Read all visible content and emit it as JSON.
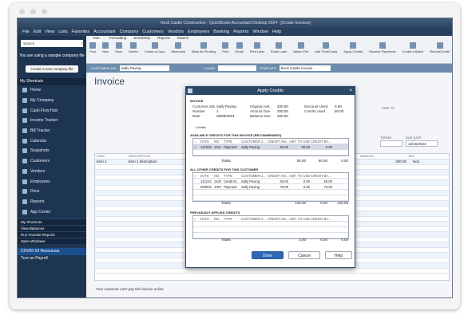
{
  "window": {
    "title": "Rock Castle Construction - QuickBooks Accountant Desktop 2024 - [Create Invoices]"
  },
  "menu": [
    "File",
    "Edit",
    "View",
    "Lists",
    "Favorites",
    "Accountant",
    "Company",
    "Customers",
    "Vendors",
    "Employees",
    "Banking",
    "Reports",
    "Window",
    "Help"
  ],
  "sidebar": {
    "search_placeholder": "Search",
    "sample_notice": "You are using a sample company file",
    "create_button": "Create a new company file",
    "my_shortcuts": "My Shortcuts",
    "items": [
      {
        "label": "Home"
      },
      {
        "label": "My Company"
      },
      {
        "label": "Cash Flow Hub"
      },
      {
        "label": "Income Tracker"
      },
      {
        "label": "Bill Tracker"
      },
      {
        "label": "Calendar"
      },
      {
        "label": "Snapshots"
      },
      {
        "label": "Customers"
      },
      {
        "label": "Vendors"
      },
      {
        "label": "Employees"
      },
      {
        "label": "Docs"
      },
      {
        "label": "Reports"
      },
      {
        "label": "App Center"
      }
    ],
    "sections": [
      "My Shortcuts",
      "View Balances",
      "Run Favorite Reports",
      "Open Windows"
    ],
    "covid": "COVID-19 Resources",
    "turn_on_payroll": "Turn on Payroll"
  },
  "ribbon": {
    "tabs": [
      "Main",
      "Formatting",
      "Send/Ship",
      "Reports",
      "Search"
    ],
    "tools": [
      "Find",
      "New",
      "Save",
      "Delete",
      "Create a Copy",
      "Memorize",
      "Mark As Pending",
      "Print",
      "Email",
      "Print Later",
      "Email Later",
      "Attach File",
      "Add Time/Costs",
      "Apply Credits",
      "Receive Payments",
      "Create a Batch",
      "Refund/Credit"
    ]
  },
  "customer_bar": {
    "customer_job_label": "CUSTOMER:JOB",
    "customer_job_value": "Sally Paving",
    "class_label": "CLASS",
    "template_label": "TEMPLATE",
    "template_value": "Rock Castle Invoice"
  },
  "invoice": {
    "title": "Invoice",
    "terms_label": "TERMS",
    "ship_to_label": "SHIP TO",
    "date_label": "DATE",
    "due_date_label": "DUE DATE",
    "due_date": "12/15/2024",
    "columns": [
      "ITEM",
      "DESCRIPTION",
      "",
      "",
      "",
      "AMOUNT",
      "TAX"
    ],
    "rows": [
      {
        "item": "Item 1",
        "description": "Item 1 description",
        "rate": "200.00",
        "tax": "Non"
      }
    ],
    "note": "Your customer can't pay this invoice online"
  },
  "dialog": {
    "title": "Apply Credits",
    "invoice_section": "INVOICE",
    "fields_left": [
      {
        "k": "Customer:Job",
        "v": "Sally Paving"
      },
      {
        "k": "Number",
        "v": "1"
      },
      {
        "k": "Date",
        "v": "08/09/2024"
      }
    ],
    "fields_mid": [
      {
        "k": "Original Amt.",
        "v": "200.00"
      },
      {
        "k": "Amount Due",
        "v": "200.00"
      },
      {
        "k": "Balance Due",
        "v": "200.00"
      }
    ],
    "fields_right": [
      {
        "k": "Discount Used",
        "v": "0.00"
      },
      {
        "k": "Credits Used",
        "v": "50.00"
      }
    ],
    "credits_label": "Credits",
    "available_title": "AVAILABLE CREDITS FOR THIS INVOICE (RECOMMENDED)",
    "table_headers": [
      "✓",
      "DATE",
      "NO.",
      "TYPE",
      "CUSTOMER:J...",
      "CREDIT AM...",
      "AMT. TO USE",
      "CREDIT BA..."
    ],
    "available_rows": [
      {
        "check": "✓",
        "date": "12/10/2",
        "no": "1112",
        "type": "Payment",
        "customer": "Sally Paving",
        "credit": "50.00",
        "use": "50.00",
        "balance": "0.00"
      }
    ],
    "available_totals": {
      "label": "Totals",
      "credit": "50.00",
      "use": "50.00",
      "balance": "0.00"
    },
    "other_title": "ALL OTHER CREDITS FOR THIS CUSTOMER",
    "other_rows": [
      {
        "check": "",
        "date": "12/11/2",
        "no": "1103",
        "type": "Credit M...",
        "customer": "Sally Paving",
        "credit": "50.00",
        "use": "0.00",
        "balance": "50.00"
      },
      {
        "check": "",
        "date": "08/09/2",
        "no": "1007",
        "type": "Payment",
        "customer": "Sally Paving",
        "credit": "75.00",
        "use": "0.00",
        "balance": "75.00"
      }
    ],
    "other_totals": {
      "label": "Totals",
      "credit": "125.00",
      "use": "0.00",
      "balance": "125.00"
    },
    "previous_title": "PREVIOUSLY APPLIED CREDITS",
    "previous_totals": {
      "label": "Totals",
      "credit": "2.00",
      "use": "0.00",
      "balance": "0.00"
    },
    "buttons": {
      "done": "Done",
      "cancel": "Cancel",
      "help": "Help"
    }
  }
}
